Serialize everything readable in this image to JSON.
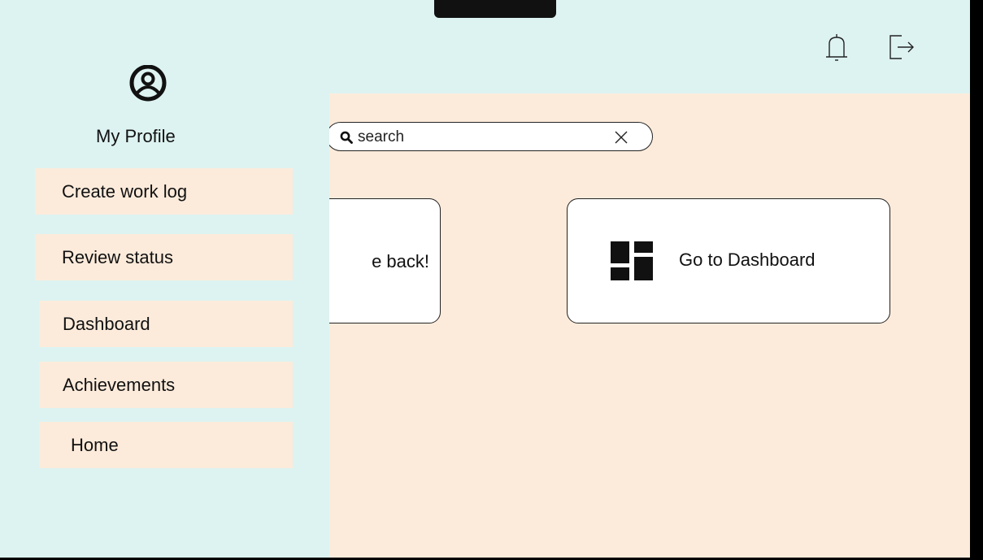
{
  "header": {
    "icons": [
      "bell-icon",
      "logout-icon"
    ]
  },
  "sidebar": {
    "profile_label": "My Profile",
    "profile_icon": "user-circle-icon",
    "items": [
      {
        "label": "Create work log"
      },
      {
        "label": "Review status"
      },
      {
        "label": "Dashboard"
      },
      {
        "label": "Achievements"
      },
      {
        "label": "Home"
      }
    ]
  },
  "search": {
    "placeholder": "search",
    "icon": "search-icon",
    "clear_icon": "close-icon"
  },
  "cards": {
    "welcome_text": "e back!",
    "dashboard_label": "Go to Dashboard",
    "dashboard_icon": "dashboard-grid-icon"
  },
  "colors": {
    "sidebar_bg": "#ddf3f1",
    "content_bg": "#fcebdb",
    "card_bg": "#ffffff"
  }
}
